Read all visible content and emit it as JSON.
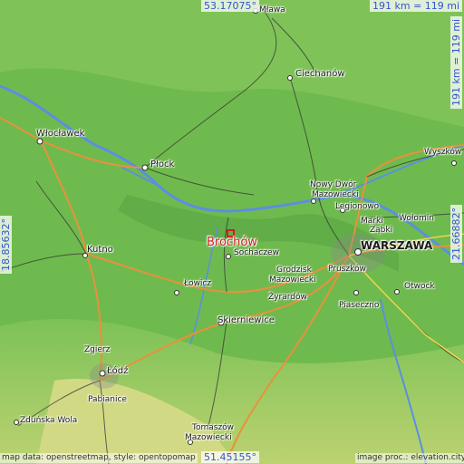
{
  "map": {
    "target": "Brochów",
    "coords": {
      "top": "53.17075°",
      "bottom": "51.45155°",
      "left": "18.85632°",
      "right": "21.66882°"
    },
    "scale": {
      "horizontal": "191 km = 119 mi",
      "vertical": "191 km = 119 mi"
    },
    "credits": {
      "left": "map data: openstreetmap, style: opentopomap",
      "right": "image proc.: elevation.city"
    },
    "places": [
      "Mława",
      "Ciechanów",
      "Włocławek",
      "Płock",
      "Nowy Dwór",
      "Mazowiecki",
      "Legionowo",
      "Wyszków",
      "Ząbki",
      "Marki",
      "Wołomin",
      "WARSZAWA",
      "Brochów",
      "Sochaczew",
      "Kutno",
      "Łowicz",
      "Grodzisk",
      "Mazowiecki",
      "Pruszków",
      "Żyrardów",
      "Otwock",
      "Piaseczno",
      "Skierniewice",
      "Zgierz",
      "Łódź",
      "Pabianice",
      "Zduńska Wola",
      "Tomaszów",
      "Mazowiecki"
    ]
  },
  "colors": {
    "water": "#5b8fe0",
    "lowland": "#6fba4e",
    "highland": "#c9d67a",
    "target": "#d21e1e"
  }
}
